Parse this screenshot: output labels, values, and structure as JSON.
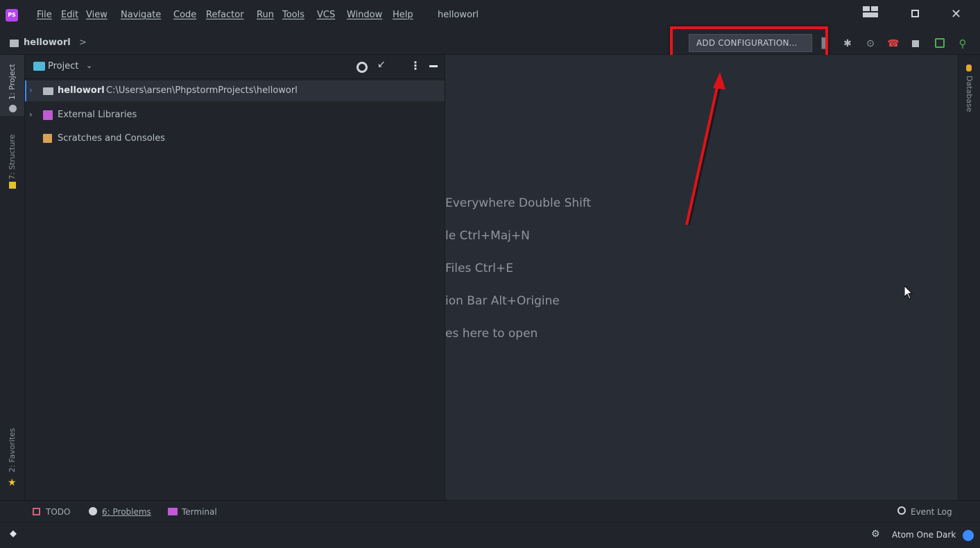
{
  "menu": {
    "items": [
      {
        "label": "File"
      },
      {
        "label": "Edit"
      },
      {
        "label": "View"
      },
      {
        "label": "Navigate"
      },
      {
        "label": "Code"
      },
      {
        "label": "Refactor"
      },
      {
        "label": "Run"
      },
      {
        "label": "Tools"
      },
      {
        "label": "VCS"
      },
      {
        "label": "Window"
      },
      {
        "label": "Help"
      }
    ],
    "project_title": "helloworl"
  },
  "navbar": {
    "breadcrumb": "helloworl",
    "breadcrumb_sep": ">",
    "add_config_label": "ADD CONFIGURATION..."
  },
  "left_tabs": {
    "project": "1: Project",
    "structure": "7: Structure",
    "favorites": "2: Favorites"
  },
  "right_tabs": {
    "database": "Database"
  },
  "project_panel": {
    "title": "Project",
    "tree": [
      {
        "name": "helloworl",
        "path": "C:\\Users\\arsen\\PhpstormProjects\\helloworl"
      },
      {
        "name": "External Libraries"
      },
      {
        "name": "Scratches and Consoles"
      }
    ]
  },
  "editor_hints": [
    "Everywhere  Double Shift",
    "le  Ctrl+Maj+N",
    "Files  Ctrl+E",
    "ion Bar  Alt+Origine",
    "es here to open"
  ],
  "bottom_tools": {
    "todo": "TODO",
    "problems": "6: Problems",
    "terminal": "Terminal",
    "event_log": "Event Log"
  },
  "status": {
    "theme": "Atom One Dark"
  },
  "colors": {
    "highlight_box": "#e8141c",
    "arrow": "#e01218",
    "accent_blue": "#3d8bff"
  }
}
